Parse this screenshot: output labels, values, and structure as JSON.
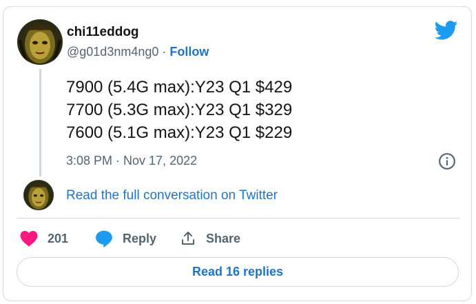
{
  "author": {
    "display_name": "chi11eddog",
    "handle": "@g01d3nm4ng0",
    "separator": "·",
    "follow_label": "Follow"
  },
  "tweet": {
    "lines": [
      "7900 (5.4G max):Y23 Q1 $429",
      "7700 (5.3G max):Y23 Q1 $329",
      "7600 (5.1G max):Y23 Q1 $229"
    ],
    "timestamp": "3:08 PM · Nov 17, 2022"
  },
  "conversation": {
    "link_label": "Read the full conversation on Twitter"
  },
  "actions": {
    "like_count": "201",
    "reply_label": "Reply",
    "share_label": "Share"
  },
  "replies_button": {
    "label": "Read 16 replies"
  },
  "icons": {
    "brand": "twitter-bird-icon",
    "like": "heart-icon",
    "reply": "speech-bubble-icon",
    "share": "share-upload-icon",
    "info": "info-icon"
  },
  "colors": {
    "link_blue": "#1d74c6",
    "twitter_blue": "#1d9bf0",
    "like_pink": "#f91880",
    "muted_text": "#536471",
    "border": "#cfd9de"
  }
}
